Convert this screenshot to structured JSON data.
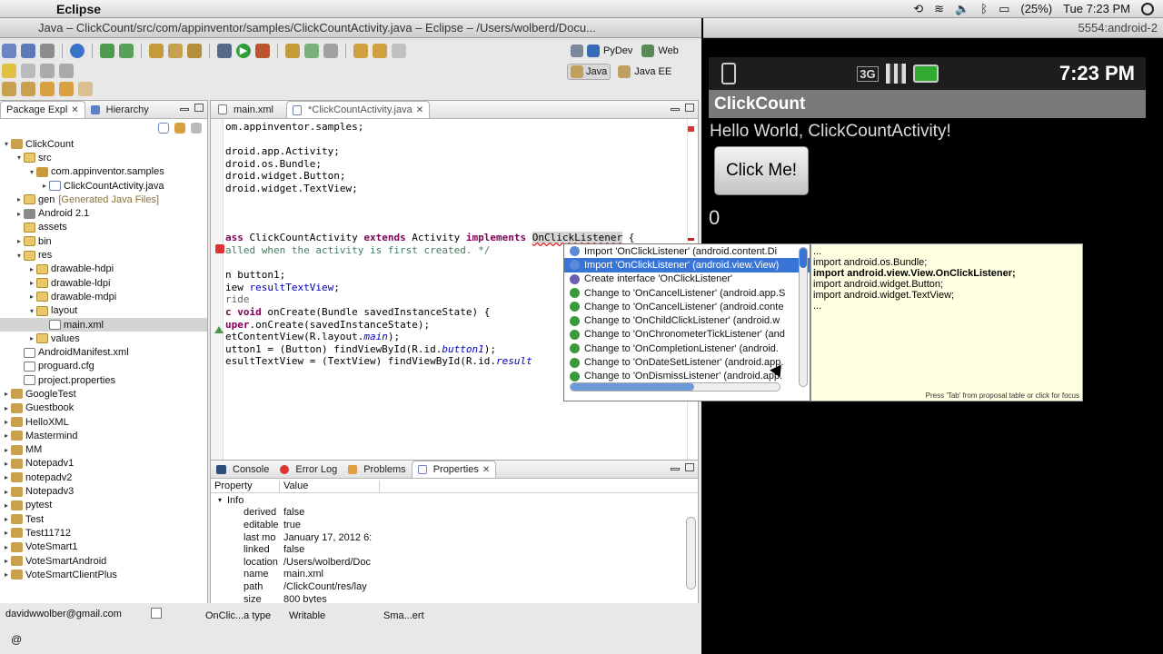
{
  "menubar": {
    "app_name": "Eclipse",
    "battery": "(25%)",
    "clock": "Tue 7:23 PM"
  },
  "window": {
    "title": "Java – ClickCount/src/com/appinventor/samples/ClickCountActivity.java – Eclipse – /Users/wolberd/Docu..."
  },
  "perspectives": {
    "pydev": "PyDev",
    "web": "Web",
    "java": "Java",
    "javaee": "Java EE"
  },
  "explorer": {
    "tab_package": "Package Expl",
    "tab_hierarchy": "Hierarchy",
    "items": [
      {
        "label": "ClickCount",
        "extra": "",
        "indent": 0,
        "twisty": "▾",
        "icon": "proj",
        "selected": false
      },
      {
        "label": "src",
        "extra": "",
        "indent": 1,
        "twisty": "▾",
        "icon": "folder",
        "selected": false
      },
      {
        "label": "com.appinventor.samples",
        "extra": "",
        "indent": 2,
        "twisty": "▾",
        "icon": "pkg",
        "selected": false
      },
      {
        "label": "ClickCountActivity.java",
        "extra": "",
        "indent": 3,
        "twisty": "▸",
        "icon": "java",
        "selected": false
      },
      {
        "label": "gen",
        "extra": "[Generated Java Files]",
        "indent": 1,
        "twisty": "▸",
        "icon": "folder",
        "selected": false
      },
      {
        "label": "Android 2.1",
        "extra": "",
        "indent": 1,
        "twisty": "▸",
        "icon": "lib",
        "selected": false
      },
      {
        "label": "assets",
        "extra": "",
        "indent": 1,
        "twisty": "",
        "icon": "folder",
        "selected": false
      },
      {
        "label": "bin",
        "extra": "",
        "indent": 1,
        "twisty": "▸",
        "icon": "folder",
        "selected": false
      },
      {
        "label": "res",
        "extra": "",
        "indent": 1,
        "twisty": "▾",
        "icon": "folder",
        "selected": false
      },
      {
        "label": "drawable-hdpi",
        "extra": "",
        "indent": 2,
        "twisty": "▸",
        "icon": "folder",
        "selected": false
      },
      {
        "label": "drawable-ldpi",
        "extra": "",
        "indent": 2,
        "twisty": "▸",
        "icon": "folder",
        "selected": false
      },
      {
        "label": "drawable-mdpi",
        "extra": "",
        "indent": 2,
        "twisty": "▸",
        "icon": "folder",
        "selected": false
      },
      {
        "label": "layout",
        "extra": "",
        "indent": 2,
        "twisty": "▾",
        "icon": "folder",
        "selected": false
      },
      {
        "label": "main.xml",
        "extra": "",
        "indent": 3,
        "twisty": "",
        "icon": "xml",
        "selected": true
      },
      {
        "label": "values",
        "extra": "",
        "indent": 2,
        "twisty": "▸",
        "icon": "folder",
        "selected": false
      },
      {
        "label": "AndroidManifest.xml",
        "extra": "",
        "indent": 1,
        "twisty": "",
        "icon": "xml",
        "selected": false
      },
      {
        "label": "proguard.cfg",
        "extra": "",
        "indent": 1,
        "twisty": "",
        "icon": "xml",
        "selected": false
      },
      {
        "label": "project.properties",
        "extra": "",
        "indent": 1,
        "twisty": "",
        "icon": "xml",
        "selected": false
      },
      {
        "label": "GoogleTest",
        "extra": "",
        "indent": 0,
        "twisty": "▸",
        "icon": "proj",
        "selected": false
      },
      {
        "label": "Guestbook",
        "extra": "",
        "indent": 0,
        "twisty": "▸",
        "icon": "proj",
        "selected": false
      },
      {
        "label": "HelloXML",
        "extra": "",
        "indent": 0,
        "twisty": "▸",
        "icon": "proj",
        "selected": false
      },
      {
        "label": "Mastermind",
        "extra": "",
        "indent": 0,
        "twisty": "▸",
        "icon": "proj",
        "selected": false
      },
      {
        "label": "MM",
        "extra": "",
        "indent": 0,
        "twisty": "▸",
        "icon": "proj",
        "selected": false
      },
      {
        "label": "Notepadv1",
        "extra": "",
        "indent": 0,
        "twisty": "▸",
        "icon": "proj",
        "selected": false
      },
      {
        "label": "notepadv2",
        "extra": "",
        "indent": 0,
        "twisty": "▸",
        "icon": "proj",
        "selected": false
      },
      {
        "label": "Notepadv3",
        "extra": "",
        "indent": 0,
        "twisty": "▸",
        "icon": "proj",
        "selected": false
      },
      {
        "label": "pytest",
        "extra": "",
        "indent": 0,
        "twisty": "▸",
        "icon": "proj",
        "selected": false
      },
      {
        "label": "Test",
        "extra": "",
        "indent": 0,
        "twisty": "▸",
        "icon": "proj",
        "selected": false
      },
      {
        "label": "Test11712",
        "extra": "",
        "indent": 0,
        "twisty": "▸",
        "icon": "proj",
        "selected": false
      },
      {
        "label": "VoteSmart1",
        "extra": "",
        "indent": 0,
        "twisty": "▸",
        "icon": "proj",
        "selected": false
      },
      {
        "label": "VoteSmartAndroid",
        "extra": "",
        "indent": 0,
        "twisty": "▸",
        "icon": "proj",
        "selected": false
      },
      {
        "label": "VoteSmartClientPlus",
        "extra": "",
        "indent": 0,
        "twisty": "▸",
        "icon": "proj",
        "selected": false
      }
    ]
  },
  "editor": {
    "tab_main_xml": "main.xml",
    "tab_activity": "*ClickCountActivity.java"
  },
  "autocomplete": {
    "items": [
      {
        "label": "Import 'OnClickListener' (android.content.Di",
        "icon_color": "#5b8ad6",
        "selected": false
      },
      {
        "label": "Import 'OnClickListener' (android.view.View)",
        "icon_color": "#5b8ad6",
        "selected": true
      },
      {
        "label": "Create interface 'OnClickListener'",
        "icon_color": "#6b5fb5",
        "selected": false
      },
      {
        "label": "Change to 'OnCancelListener' (android.app.S",
        "icon_color": "#3a9a3a",
        "selected": false
      },
      {
        "label": "Change to 'OnCancelListener' (android.conte",
        "icon_color": "#3a9a3a",
        "selected": false
      },
      {
        "label": "Change to 'OnChildClickListener' (android.w",
        "icon_color": "#3a9a3a",
        "selected": false
      },
      {
        "label": "Change to 'OnChronometerTickListener' (and",
        "icon_color": "#3a9a3a",
        "selected": false
      },
      {
        "label": "Change to 'OnCompletionListener' (android.",
        "icon_color": "#3a9a3a",
        "selected": false
      },
      {
        "label": "Change to 'OnDateSetListener' (android.app.",
        "icon_color": "#3a9a3a",
        "selected": false
      },
      {
        "label": "Change to 'OnDismissListener' (android.app.",
        "icon_color": "#3a9a3a",
        "selected": false
      }
    ],
    "preview_lines": [
      {
        "text": "...",
        "bold": false
      },
      {
        "text": "import android.os.Bundle;",
        "bold": false
      },
      {
        "text": "import android.view.View.OnClickListener;",
        "bold": true
      },
      {
        "text": "import android.widget.Button;",
        "bold": false
      },
      {
        "text": "import android.widget.TextView;",
        "bold": false
      },
      {
        "text": "...",
        "bold": false
      }
    ],
    "hint": "Press 'Tab' from proposal table or click for focus"
  },
  "bottom": {
    "tab_console": "Console",
    "tab_errorlog": "Error Log",
    "tab_problems": "Problems",
    "tab_properties": "Properties",
    "col_property": "Property",
    "col_value": "Value",
    "group": "Info",
    "rows": [
      {
        "key": "derived",
        "value": "false"
      },
      {
        "key": "editable",
        "value": "true"
      },
      {
        "key": "last mo",
        "value": "January 17, 2012 6:"
      },
      {
        "key": "linked",
        "value": "false"
      },
      {
        "key": "location",
        "value": "/Users/wolberd/Doc"
      },
      {
        "key": "name",
        "value": "main.xml"
      },
      {
        "key": "path",
        "value": "/ClickCount/res/lay"
      },
      {
        "key": "size",
        "value": "800  bytes"
      }
    ]
  },
  "status": {
    "user": "davidwwolber@gmail.com",
    "type": "OnClic...a type",
    "writable": "Writable",
    "insert": "Sma...ert"
  },
  "emulator": {
    "device": "5554:android-2",
    "time": "7:23 PM",
    "app_title": "ClickCount",
    "hello": "Hello World, ClickCountActivity!",
    "button": "Click Me!",
    "count": "0"
  }
}
